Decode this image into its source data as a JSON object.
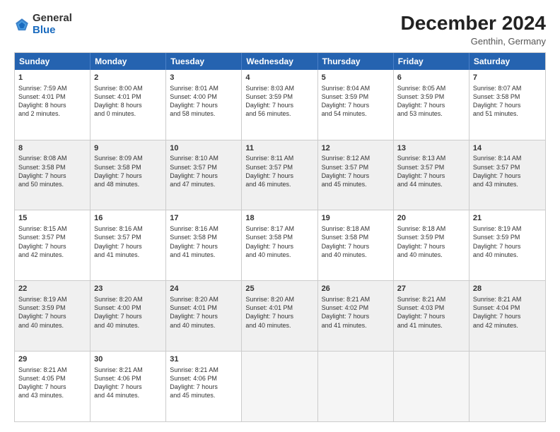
{
  "logo": {
    "text_general": "General",
    "text_blue": "Blue"
  },
  "title": "December 2024",
  "location": "Genthin, Germany",
  "days_of_week": [
    "Sunday",
    "Monday",
    "Tuesday",
    "Wednesday",
    "Thursday",
    "Friday",
    "Saturday"
  ],
  "weeks": [
    [
      {
        "day": "1",
        "info": "Sunrise: 7:59 AM\nSunset: 4:01 PM\nDaylight: 8 hours\nand 2 minutes.",
        "shaded": false,
        "empty": false
      },
      {
        "day": "2",
        "info": "Sunrise: 8:00 AM\nSunset: 4:01 PM\nDaylight: 8 hours\nand 0 minutes.",
        "shaded": false,
        "empty": false
      },
      {
        "day": "3",
        "info": "Sunrise: 8:01 AM\nSunset: 4:00 PM\nDaylight: 7 hours\nand 58 minutes.",
        "shaded": false,
        "empty": false
      },
      {
        "day": "4",
        "info": "Sunrise: 8:03 AM\nSunset: 3:59 PM\nDaylight: 7 hours\nand 56 minutes.",
        "shaded": false,
        "empty": false
      },
      {
        "day": "5",
        "info": "Sunrise: 8:04 AM\nSunset: 3:59 PM\nDaylight: 7 hours\nand 54 minutes.",
        "shaded": false,
        "empty": false
      },
      {
        "day": "6",
        "info": "Sunrise: 8:05 AM\nSunset: 3:59 PM\nDaylight: 7 hours\nand 53 minutes.",
        "shaded": false,
        "empty": false
      },
      {
        "day": "7",
        "info": "Sunrise: 8:07 AM\nSunset: 3:58 PM\nDaylight: 7 hours\nand 51 minutes.",
        "shaded": false,
        "empty": false
      }
    ],
    [
      {
        "day": "8",
        "info": "Sunrise: 8:08 AM\nSunset: 3:58 PM\nDaylight: 7 hours\nand 50 minutes.",
        "shaded": true,
        "empty": false
      },
      {
        "day": "9",
        "info": "Sunrise: 8:09 AM\nSunset: 3:58 PM\nDaylight: 7 hours\nand 48 minutes.",
        "shaded": true,
        "empty": false
      },
      {
        "day": "10",
        "info": "Sunrise: 8:10 AM\nSunset: 3:57 PM\nDaylight: 7 hours\nand 47 minutes.",
        "shaded": true,
        "empty": false
      },
      {
        "day": "11",
        "info": "Sunrise: 8:11 AM\nSunset: 3:57 PM\nDaylight: 7 hours\nand 46 minutes.",
        "shaded": true,
        "empty": false
      },
      {
        "day": "12",
        "info": "Sunrise: 8:12 AM\nSunset: 3:57 PM\nDaylight: 7 hours\nand 45 minutes.",
        "shaded": true,
        "empty": false
      },
      {
        "day": "13",
        "info": "Sunrise: 8:13 AM\nSunset: 3:57 PM\nDaylight: 7 hours\nand 44 minutes.",
        "shaded": true,
        "empty": false
      },
      {
        "day": "14",
        "info": "Sunrise: 8:14 AM\nSunset: 3:57 PM\nDaylight: 7 hours\nand 43 minutes.",
        "shaded": true,
        "empty": false
      }
    ],
    [
      {
        "day": "15",
        "info": "Sunrise: 8:15 AM\nSunset: 3:57 PM\nDaylight: 7 hours\nand 42 minutes.",
        "shaded": false,
        "empty": false
      },
      {
        "day": "16",
        "info": "Sunrise: 8:16 AM\nSunset: 3:57 PM\nDaylight: 7 hours\nand 41 minutes.",
        "shaded": false,
        "empty": false
      },
      {
        "day": "17",
        "info": "Sunrise: 8:16 AM\nSunset: 3:58 PM\nDaylight: 7 hours\nand 41 minutes.",
        "shaded": false,
        "empty": false
      },
      {
        "day": "18",
        "info": "Sunrise: 8:17 AM\nSunset: 3:58 PM\nDaylight: 7 hours\nand 40 minutes.",
        "shaded": false,
        "empty": false
      },
      {
        "day": "19",
        "info": "Sunrise: 8:18 AM\nSunset: 3:58 PM\nDaylight: 7 hours\nand 40 minutes.",
        "shaded": false,
        "empty": false
      },
      {
        "day": "20",
        "info": "Sunrise: 8:18 AM\nSunset: 3:59 PM\nDaylight: 7 hours\nand 40 minutes.",
        "shaded": false,
        "empty": false
      },
      {
        "day": "21",
        "info": "Sunrise: 8:19 AM\nSunset: 3:59 PM\nDaylight: 7 hours\nand 40 minutes.",
        "shaded": false,
        "empty": false
      }
    ],
    [
      {
        "day": "22",
        "info": "Sunrise: 8:19 AM\nSunset: 3:59 PM\nDaylight: 7 hours\nand 40 minutes.",
        "shaded": true,
        "empty": false
      },
      {
        "day": "23",
        "info": "Sunrise: 8:20 AM\nSunset: 4:00 PM\nDaylight: 7 hours\nand 40 minutes.",
        "shaded": true,
        "empty": false
      },
      {
        "day": "24",
        "info": "Sunrise: 8:20 AM\nSunset: 4:01 PM\nDaylight: 7 hours\nand 40 minutes.",
        "shaded": true,
        "empty": false
      },
      {
        "day": "25",
        "info": "Sunrise: 8:20 AM\nSunset: 4:01 PM\nDaylight: 7 hours\nand 40 minutes.",
        "shaded": true,
        "empty": false
      },
      {
        "day": "26",
        "info": "Sunrise: 8:21 AM\nSunset: 4:02 PM\nDaylight: 7 hours\nand 41 minutes.",
        "shaded": true,
        "empty": false
      },
      {
        "day": "27",
        "info": "Sunrise: 8:21 AM\nSunset: 4:03 PM\nDaylight: 7 hours\nand 41 minutes.",
        "shaded": true,
        "empty": false
      },
      {
        "day": "28",
        "info": "Sunrise: 8:21 AM\nSunset: 4:04 PM\nDaylight: 7 hours\nand 42 minutes.",
        "shaded": true,
        "empty": false
      }
    ],
    [
      {
        "day": "29",
        "info": "Sunrise: 8:21 AM\nSunset: 4:05 PM\nDaylight: 7 hours\nand 43 minutes.",
        "shaded": false,
        "empty": false
      },
      {
        "day": "30",
        "info": "Sunrise: 8:21 AM\nSunset: 4:06 PM\nDaylight: 7 hours\nand 44 minutes.",
        "shaded": false,
        "empty": false
      },
      {
        "day": "31",
        "info": "Sunrise: 8:21 AM\nSunset: 4:06 PM\nDaylight: 7 hours\nand 45 minutes.",
        "shaded": false,
        "empty": false
      },
      {
        "day": "",
        "info": "",
        "shaded": false,
        "empty": true
      },
      {
        "day": "",
        "info": "",
        "shaded": false,
        "empty": true
      },
      {
        "day": "",
        "info": "",
        "shaded": false,
        "empty": true
      },
      {
        "day": "",
        "info": "",
        "shaded": false,
        "empty": true
      }
    ]
  ]
}
